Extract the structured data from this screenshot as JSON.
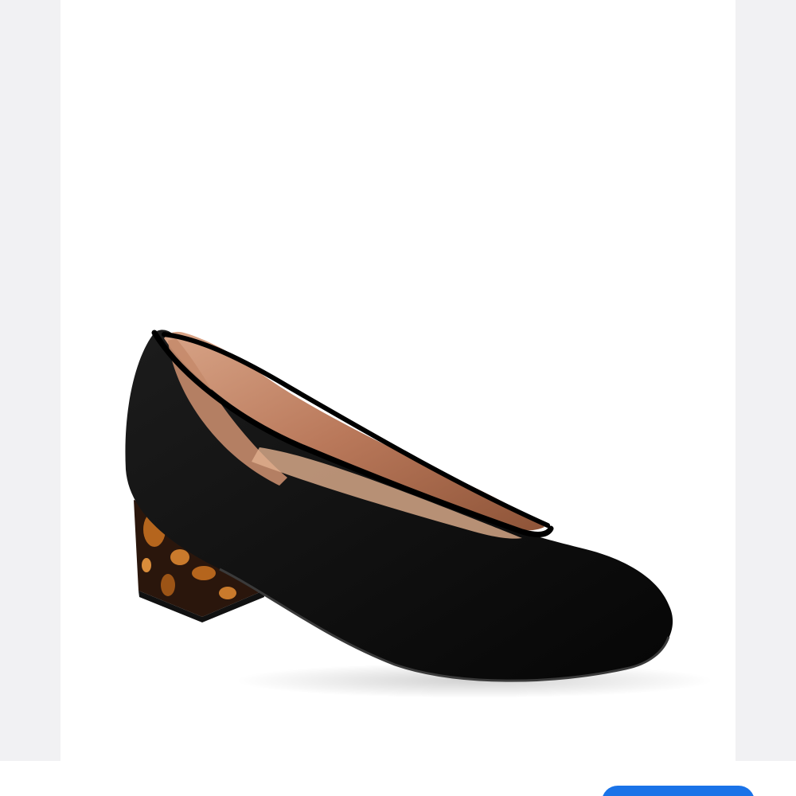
{
  "photo": {
    "subject": "black-suede-block-heel-pump",
    "colors": {
      "background": "#ffffff",
      "suede": "#111111",
      "lining": "#b9785a",
      "heel_dark": "#2a160c",
      "heel_light": "#b5651d",
      "page": "#f1f1f3"
    }
  },
  "bottom_bar": {
    "button_color": "#1a73e8",
    "button_label": ""
  }
}
